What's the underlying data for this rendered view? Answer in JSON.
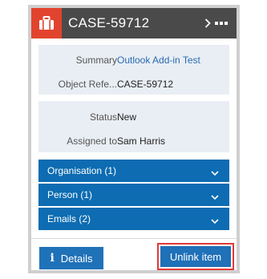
{
  "header": {
    "title": "CASE-59712",
    "icon": "briefcase-icon",
    "icon_bg": "#e2432e"
  },
  "fields_primary": [
    {
      "label": "Summary",
      "value": "Outlook Add-in Test",
      "is_link": true
    },
    {
      "label": "Object Refe...",
      "value": "CASE-59712",
      "is_link": false
    }
  ],
  "fields_secondary": [
    {
      "label": "Status",
      "value": "New"
    },
    {
      "label": "Assigned to",
      "value": "Sam Harris"
    }
  ],
  "related": [
    {
      "label": "Organisation (1)"
    },
    {
      "label": "Person (1)"
    },
    {
      "label": "Emails (2)"
    }
  ],
  "footer": {
    "details_label": "Details",
    "unlink_label": "Unlink item"
  },
  "colors": {
    "accent": "#0d6cb2",
    "header_bg": "#4a4a4a",
    "highlight": "#e03a3a"
  }
}
